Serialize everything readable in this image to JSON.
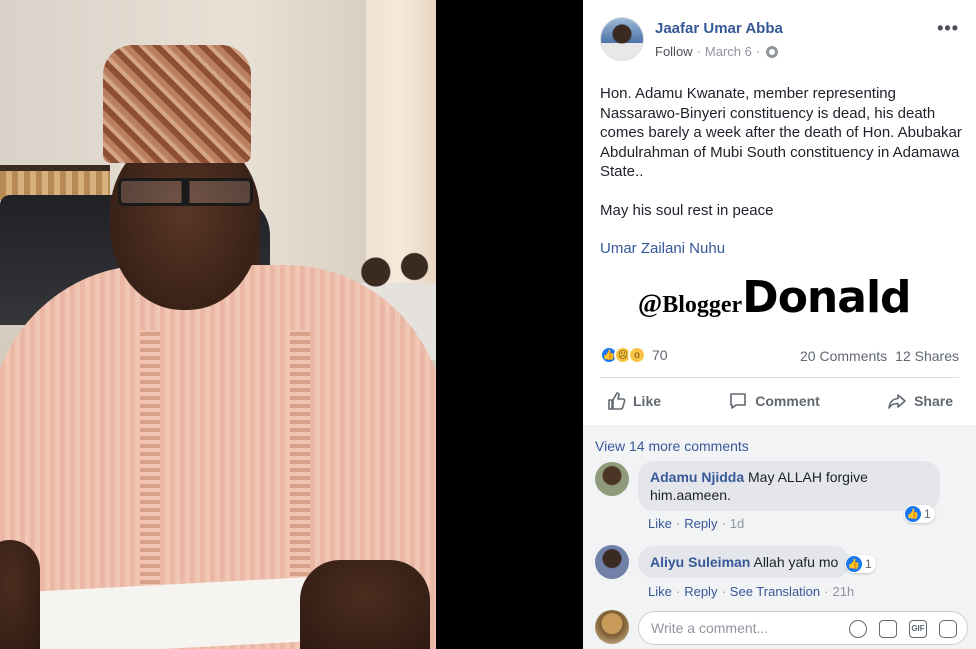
{
  "post": {
    "author": "Jaafar Umar Abba",
    "follow_label": "Follow",
    "date": "March 6",
    "date_separator": "·",
    "more_label": "•••",
    "paragraphs": [
      "Hon. Adamu Kwanate, member representing Nassarawo-Binyeri constituency is dead, his death comes barely a week after the death of Hon. Abubakar Abdulrahman of Mubi South constituency in Adamawa State..",
      "May his soul rest in peace"
    ],
    "mention": "Umar Zailani Nuhu",
    "watermark": {
      "at": "@",
      "blogger": "Blogger",
      "donald": "Donald"
    },
    "reaction_count": "70",
    "comments_count": "20 Comments",
    "shares_count": "12 Shares",
    "actions": {
      "like": "Like",
      "comment": "Comment",
      "share": "Share"
    }
  },
  "comments": {
    "view_more": "View 14 more comments",
    "items": [
      {
        "name": "Adamu Njidda",
        "text": "May ALLAH forgive him.aameen.",
        "like": "Like",
        "reply": "Reply",
        "time": "1d",
        "reaction_count": "1"
      },
      {
        "name": "Aliyu Suleiman",
        "text": "Allah yafu mo",
        "like": "Like",
        "reply": "Reply",
        "translation": "See Translation",
        "time": "21h",
        "reaction_count": "1"
      }
    ],
    "write_placeholder": "Write a comment...",
    "gif_label": "GIF"
  },
  "colors": {
    "link": "#365899",
    "reaction_blue": "#1877f2",
    "comment_bg": "#f2f3f5"
  }
}
